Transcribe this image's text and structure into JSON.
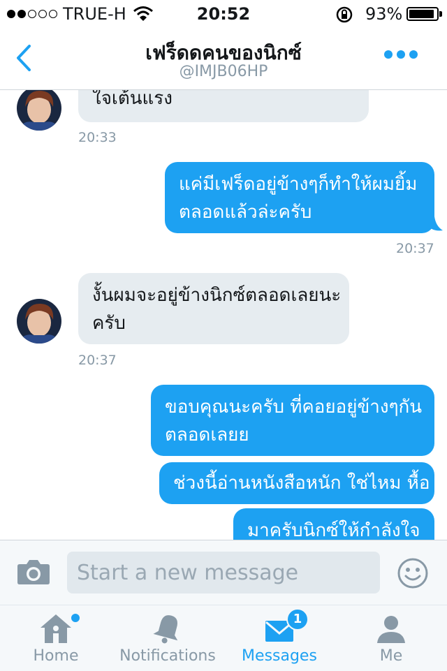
{
  "status_bar": {
    "carrier": "TRUE-H",
    "time": "20:52",
    "battery_percent": "93%",
    "battery_level": 0.93,
    "signal_bars_filled": 2,
    "signal_bars_total": 5
  },
  "header": {
    "name": "เฟร็ดดคนของนิกซ์",
    "handle": "@IMJB06HP",
    "back_icon": "chevron-left-icon",
    "more_icon": "more-dots-icon"
  },
  "messages": [
    {
      "direction": "in",
      "lines": [
        "ใจเต้นแรง"
      ],
      "time": "20:33"
    },
    {
      "direction": "out",
      "lines": [
        "แค่มีเฟร็ดอยู่ข้างๆก็ทำให้ผมยิ้ม",
        "ตลอดแล้วล่ะครับ"
      ],
      "time": "20:37"
    },
    {
      "direction": "in",
      "lines": [
        "งั้นผมจะอยู่ข้างนิกซ์ตลอดเลยนะ",
        "ครับ"
      ],
      "time": "20:37"
    },
    {
      "direction": "out",
      "lines": [
        "ขอบคุณนะครับ ที่คอยอยู่ข้างๆกัน",
        "ตลอดเลยย"
      ]
    },
    {
      "direction": "out",
      "lines": [
        "ช่วงนี้อ่านหนังสือหนัก ใช่ไหม หื้อ"
      ]
    },
    {
      "direction": "out",
      "lines": [
        "มาครับนิกซ์ให้กำลังใจ"
      ]
    }
  ],
  "composer": {
    "placeholder": "Start a new message",
    "camera_icon": "camera-icon",
    "emoji_icon": "emoji-smile-icon"
  },
  "tabs": [
    {
      "label": "Home",
      "icon": "home-icon",
      "active": false,
      "dot": true
    },
    {
      "label": "Notifications",
      "icon": "bell-icon",
      "active": false
    },
    {
      "label": "Messages",
      "icon": "envelope-icon",
      "active": true,
      "badge": "1"
    },
    {
      "label": "Me",
      "icon": "person-icon",
      "active": false
    }
  ],
  "colors": {
    "accent": "#1da1f2",
    "incoming_bubble": "#e6ecf0",
    "muted_text": "#8899a6"
  }
}
